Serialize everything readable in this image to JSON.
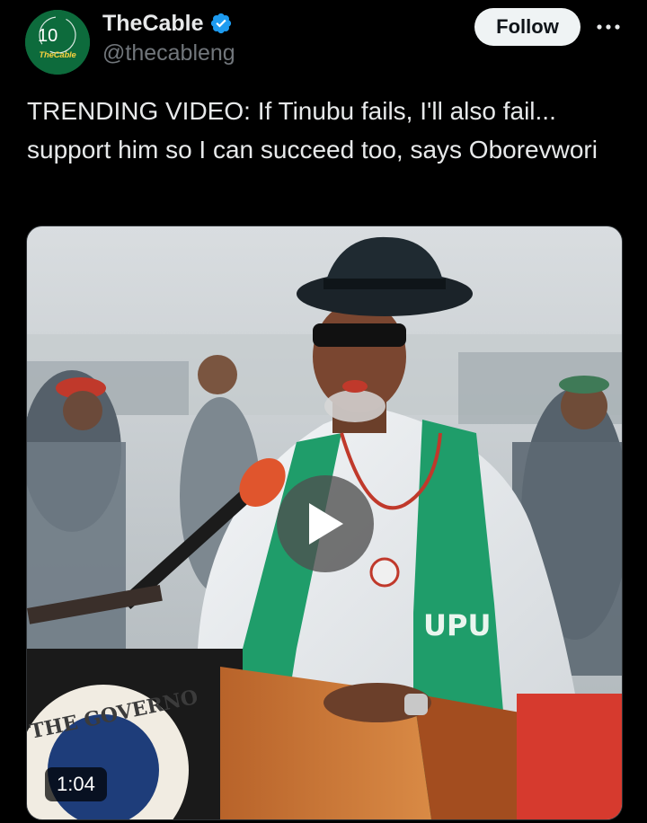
{
  "account": {
    "display_name": "TheCable",
    "handle": "@thecableng",
    "avatar_text": "TheCable",
    "avatar_anniversary": "10",
    "verified_icon": "verified-badge-icon",
    "verified_color": "#1d9bf0"
  },
  "actions": {
    "follow_label": "Follow",
    "more_icon": "more-horizontal-icon"
  },
  "tweet": {
    "text": "TRENDING VIDEO: If Tinubu fails, I'll also fail... support him so I can succeed too, says Oborevwori"
  },
  "video": {
    "duration": "1:04",
    "play_icon": "play-icon",
    "sash_text": "UPU",
    "podium_text": "THE GOVERNO"
  },
  "colors": {
    "background": "#000000",
    "text_primary": "#e7e9ea",
    "text_secondary": "#71767b",
    "follow_bg": "#eff3f4",
    "follow_text": "#0f1419",
    "border": "#2f3336"
  }
}
